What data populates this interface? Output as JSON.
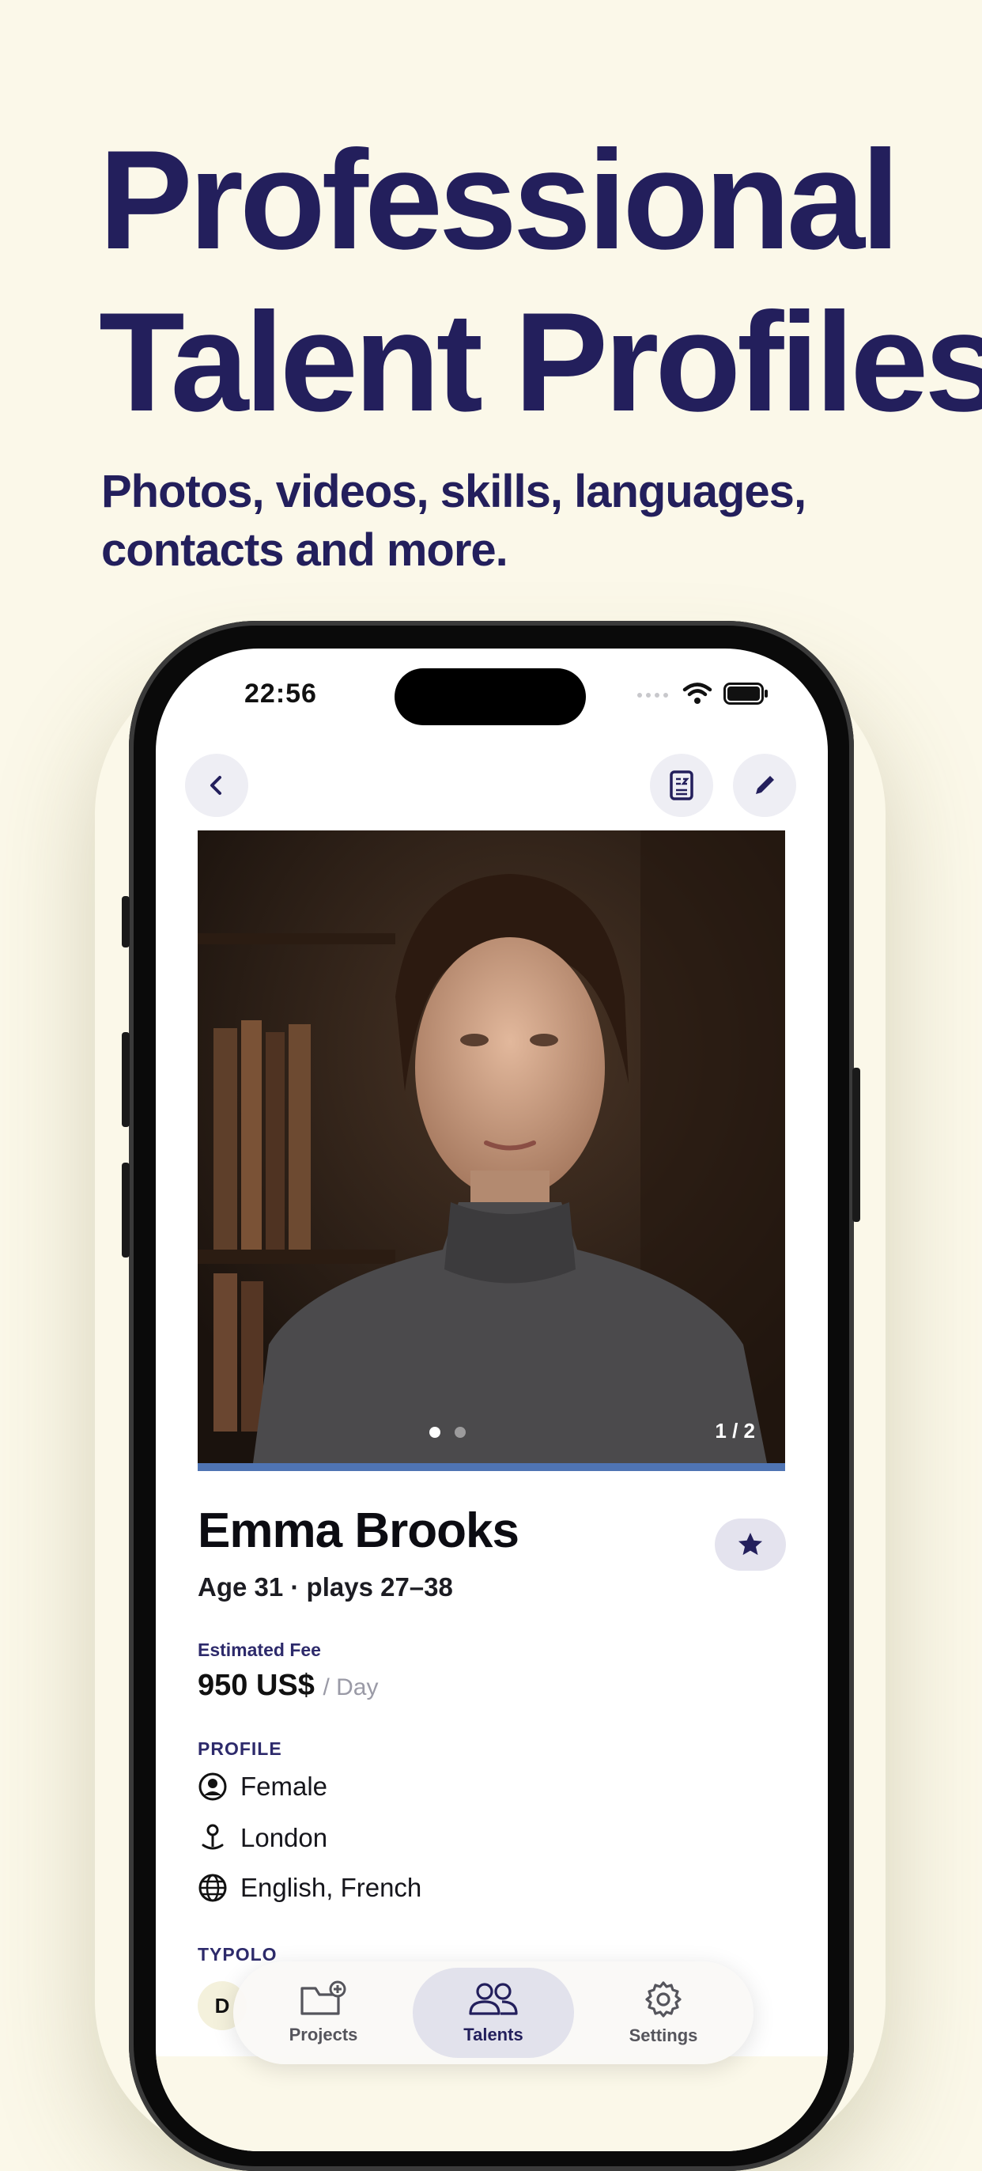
{
  "headline": {
    "line1": "Professional",
    "line2": "Talent Profiles"
  },
  "subheadline": {
    "line1": "Photos, videos, skills, languages,",
    "line2": "contacts and more."
  },
  "status_bar": {
    "time": "22:56"
  },
  "nav": {
    "back_icon": "chevron-left-icon",
    "actions": [
      "contact-card-icon",
      "pencil-icon"
    ]
  },
  "gallery": {
    "counter": "1 / 2",
    "current_index": 1,
    "total": 2
  },
  "profile": {
    "name": "Emma Brooks",
    "age_line": "Age 31 · plays 27–38",
    "fee_label": "Estimated Fee",
    "fee_value": "950 US$",
    "fee_unit": "/ Day",
    "section_profile": "PROFILE",
    "gender": "Female",
    "location": "London",
    "languages": "English, French",
    "section_typology": "TYPOLO",
    "chip_peek": "D"
  },
  "tabbar": {
    "items": [
      {
        "label": "Projects",
        "icon": "folder-plus-icon"
      },
      {
        "label": "Talents",
        "icon": "people-icon"
      },
      {
        "label": "Settings",
        "icon": "gear-icon"
      }
    ],
    "active": "Talents"
  },
  "colors": {
    "brand_navy": "#231f5c",
    "background_cream": "#fbf8e9",
    "photo_bar_blue": "#4f74b3"
  }
}
